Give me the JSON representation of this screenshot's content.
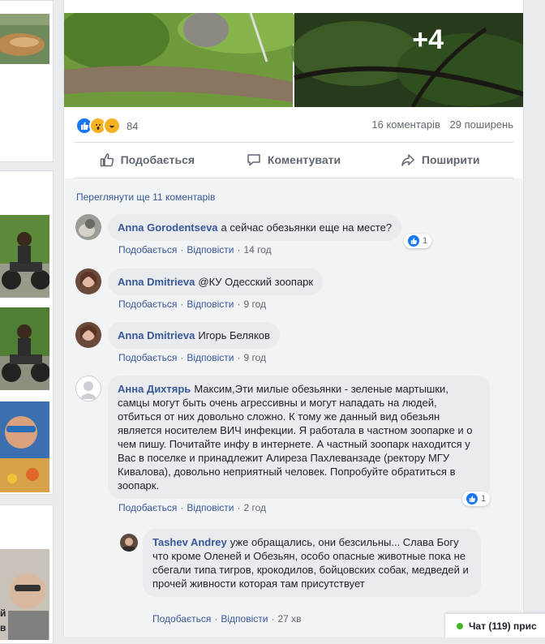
{
  "post": {
    "more_photos": "+4",
    "reactions_count": "84",
    "comments_count": "16 коментарів",
    "shares_count": "29 поширень",
    "actions": {
      "like": "Подобається",
      "comment": "Коментувати",
      "share": "Поширити"
    }
  },
  "comments_section": {
    "view_more": "Переглянути ще 11 коментарів",
    "comments": [
      {
        "author": "Anna Gorodentseva",
        "text": "а сейчас обезьянки еще на месте?",
        "like": "Подобається",
        "reply": "Відповісти",
        "time": "14 год",
        "likes": "1"
      },
      {
        "author": "Anna Dmitrieva",
        "text": "@КУ Одесский зоопарк",
        "like": "Подобається",
        "reply": "Відповісти",
        "time": "9 год"
      },
      {
        "author": "Anna Dmitrieva",
        "text": "Игорь Беляков",
        "like": "Подобається",
        "reply": "Відповісти",
        "time": "9 год"
      },
      {
        "author": "Анна Дихтярь",
        "text": "Максим,Эти милые обезьянки - зеленые мартышки, самцы могут быть очень агрессивны и могут нападать на людей, отбиться от них довольно сложно. К тому же данный вид обезьян является носителем ВИЧ инфекции. Я работала в частном зоопарке и о чем пишу. Почитайте инфу в интернете. А частный зоопарк находится у Вас в поселке и принадлежит Алиреза Пахлеванзаде (ректору МГУ Кивалова), довольно неприятный человек. Попробуйте обратиться в зоопарк.",
        "like": "Подобається",
        "reply": "Відповісти",
        "time": "2 год",
        "likes": "1"
      }
    ],
    "reply": {
      "author": "Tashev Andrey",
      "text": "уже обращались, они безсильны... Слава Богу что кроме Оленей и Обезьян, особо опасные животные пока не сбегали типа тигров, крокодилов, бойцовских собак, медведей и прочей живности которая там присутствует",
      "like": "Подобається",
      "reply": "Відповісти",
      "time": "27 хв"
    }
  },
  "left_column": {
    "crop_text_1": "й",
    "crop_text_2": "в"
  },
  "chat": {
    "label": "Чат (119) прис"
  },
  "colors": {
    "link": "#385898",
    "like_blue": "#1877f2",
    "online_green": "#42b72a"
  }
}
